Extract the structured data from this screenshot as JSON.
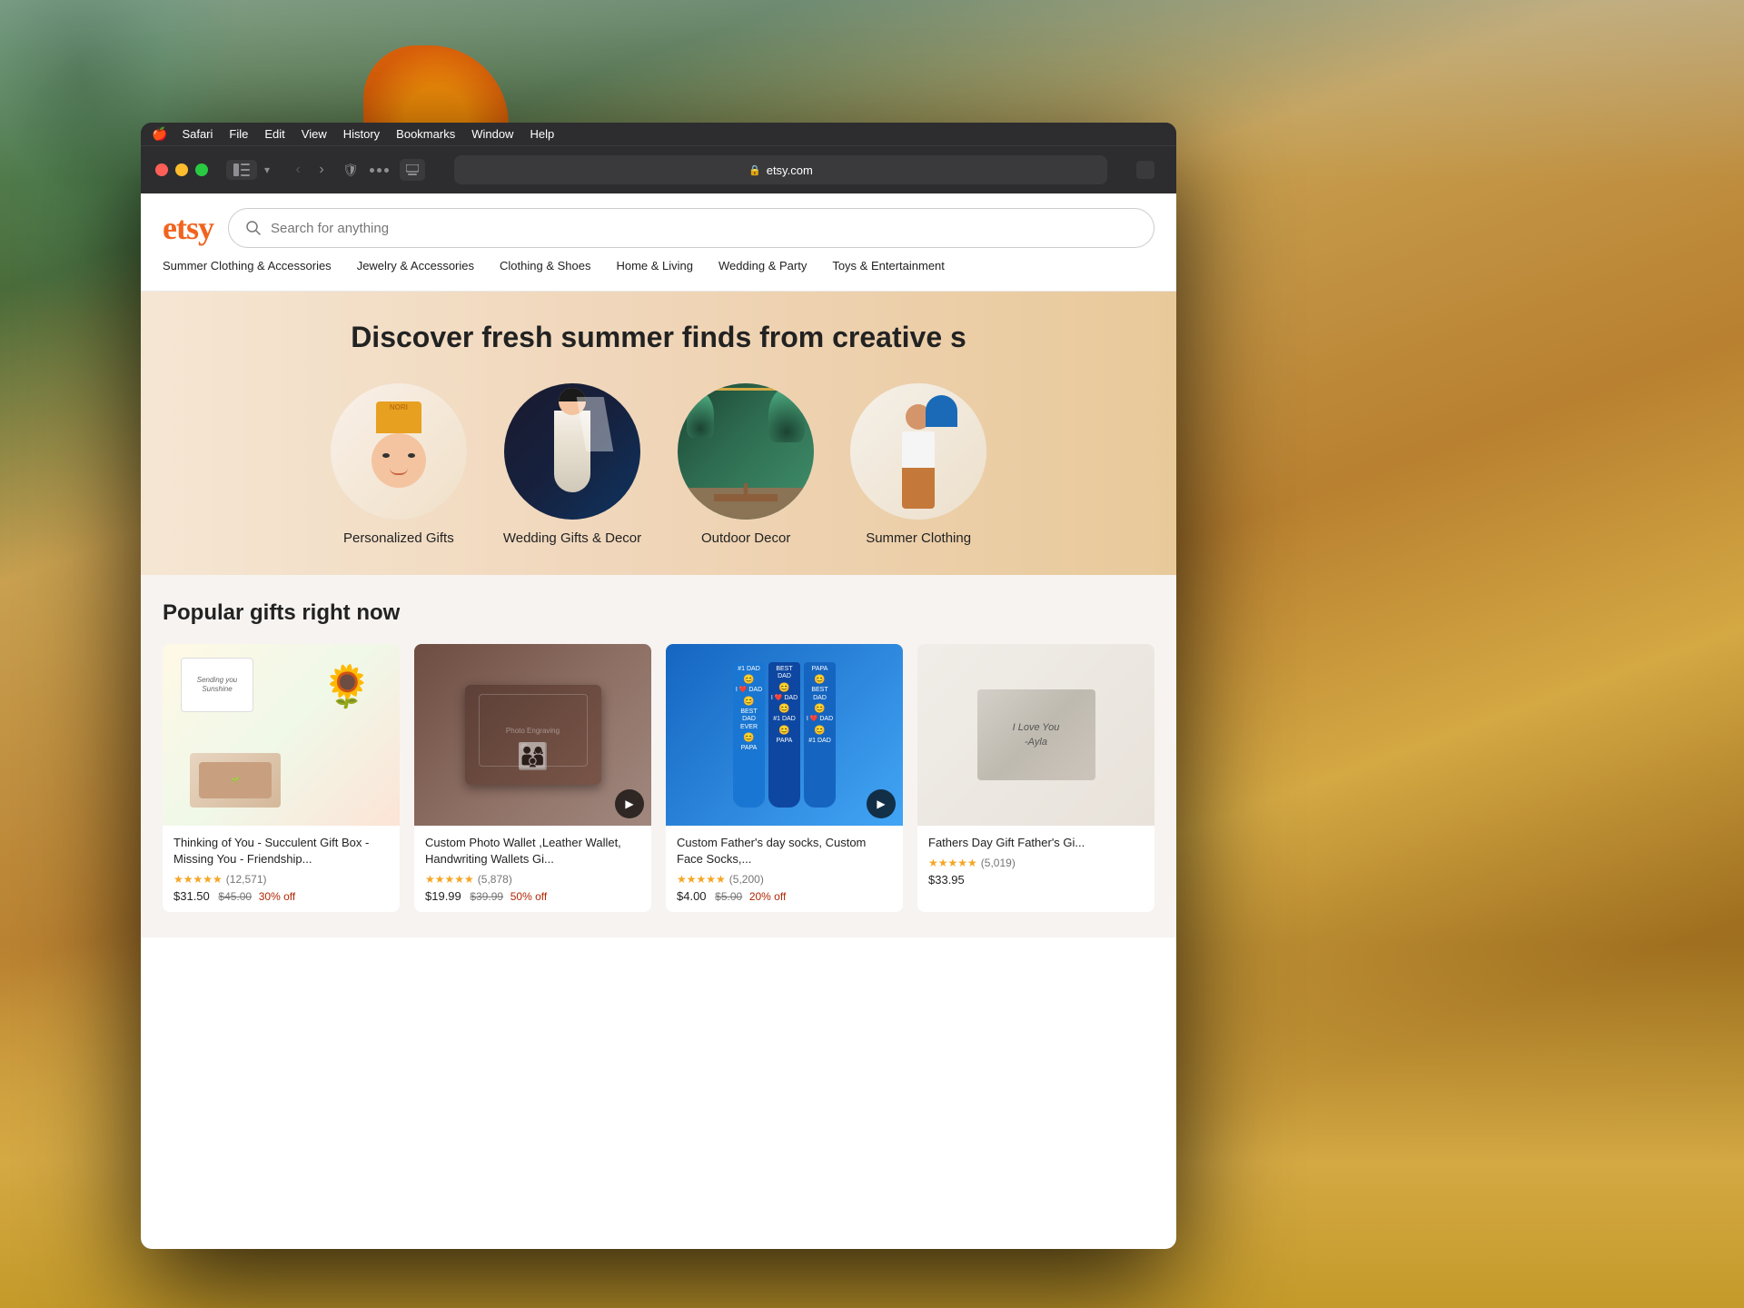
{
  "background": {
    "color": "#8B6914"
  },
  "mac": {
    "menu_bar": {
      "apple": "🍎",
      "items": [
        "Safari",
        "File",
        "Edit",
        "View",
        "History",
        "Bookmarks",
        "Window",
        "Help"
      ]
    },
    "toolbar": {
      "address": "etsy.com",
      "back_arrow": "‹",
      "forward_arrow": "›"
    }
  },
  "etsy": {
    "logo": "etsy",
    "search_placeholder": "Search for anything",
    "nav_items": [
      "Summer Clothing & Accessories",
      "Jewelry & Accessories",
      "Clothing & Shoes",
      "Home & Living",
      "Wedding & Party",
      "Toys & Entertainment"
    ],
    "hero_title": "Discover fresh summer finds from creative s",
    "categories": [
      {
        "label": "Personalized Gifts",
        "emoji": "👶"
      },
      {
        "label": "Wedding Gifts & Decor",
        "emoji": "👰"
      },
      {
        "label": "Outdoor Decor",
        "emoji": "🌿"
      },
      {
        "label": "Summer Clothing",
        "emoji": "🧍"
      }
    ],
    "popular_section_title": "Popular gifts right now",
    "products": [
      {
        "title": "Thinking of You - Succulent Gift Box - Missing You - Friendship...",
        "stars": "★★★★★",
        "review_count": "(12,571)",
        "price": "$31.50",
        "original_price": "$45.00",
        "off": "30% off",
        "has_video": false,
        "emoji": "🌻"
      },
      {
        "title": "Custom Photo Wallet ,Leather Wallet, Handwriting Wallets Gi...",
        "stars": "★★★★★",
        "review_count": "(5,878)",
        "price": "$19.99",
        "original_price": "$39.99",
        "off": "50% off",
        "has_video": true,
        "emoji": "👜"
      },
      {
        "title": "Custom Father's day socks, Custom Face Socks,...",
        "stars": "★★★★★",
        "review_count": "(5,200)",
        "price": "$4.00",
        "original_price": "$5.00",
        "off": "20% off",
        "has_video": true,
        "emoji": "🧦"
      },
      {
        "title": "Fathers Day Gift Father's Gi...",
        "stars": "★★★★★",
        "review_count": "(5,019)",
        "price": "$33.95",
        "original_price": "",
        "off": "",
        "has_video": false,
        "emoji": "📦"
      }
    ]
  }
}
